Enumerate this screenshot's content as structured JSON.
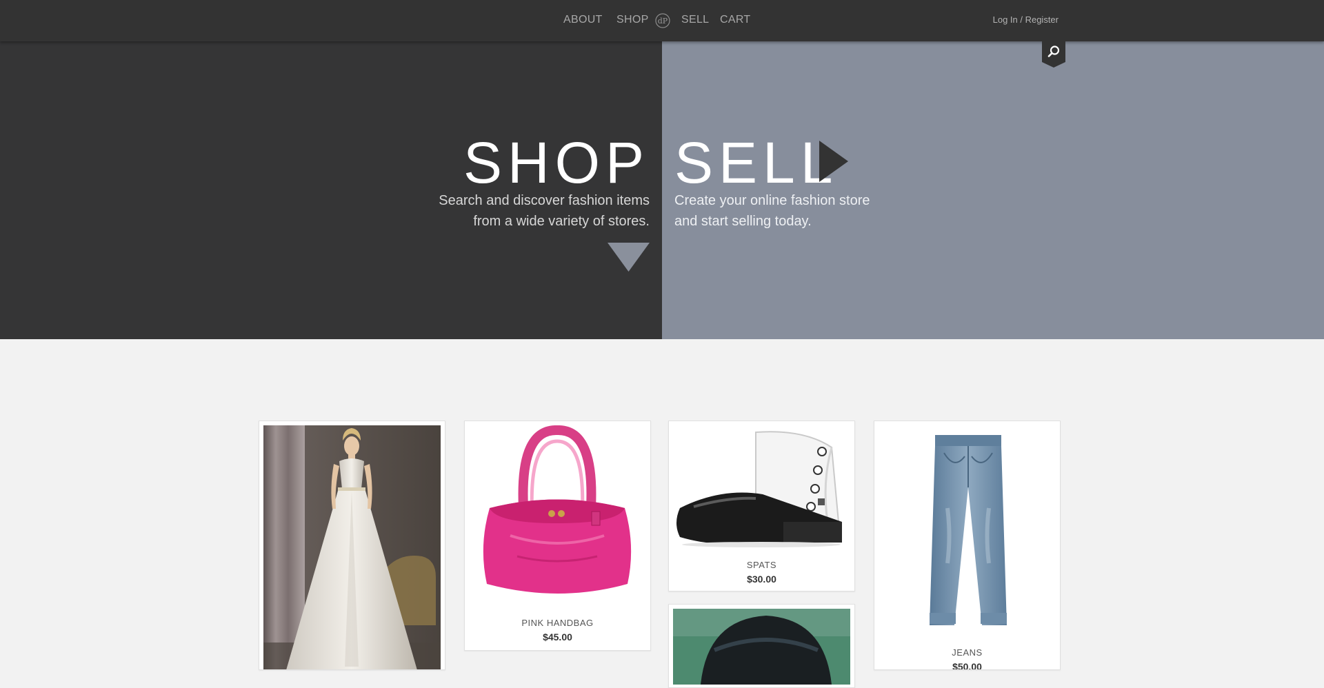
{
  "nav": {
    "links": [
      {
        "label": "ABOUT"
      },
      {
        "label": "SHOP"
      },
      {
        "label": "SELL"
      },
      {
        "label": "CART"
      }
    ],
    "logo_icon": "monogram-logo-icon",
    "login_label": "Log In / Register",
    "search_icon": "search-icon"
  },
  "hero": {
    "shop": {
      "title": "SHOP",
      "subtitle_line1": "Search and discover fashion items",
      "subtitle_line2": "from a wide variety of stores."
    },
    "sell": {
      "title": "SELL",
      "subtitle_line1": "Create your online fashion store",
      "subtitle_line2": "and start selling today."
    },
    "arrow_right_icon": "triangle-right-icon",
    "arrow_down_icon": "triangle-down-icon"
  },
  "products": [
    {
      "name": "",
      "price": "",
      "image": "wedding-dress"
    },
    {
      "name": "PINK HANDBAG",
      "price": "$45.00",
      "image": "pink-handbag"
    },
    {
      "name": "SPATS",
      "price": "$30.00",
      "image": "spats-shoe"
    },
    {
      "name": "",
      "price": "",
      "image": "cap-photo"
    },
    {
      "name": "JEANS",
      "price": "$50.00",
      "image": "jeans"
    }
  ],
  "colors": {
    "nav_bg": "#333333",
    "shop_panel": "#353536",
    "sell_panel": "#878e9c",
    "page_bg": "#f2f2f2"
  }
}
